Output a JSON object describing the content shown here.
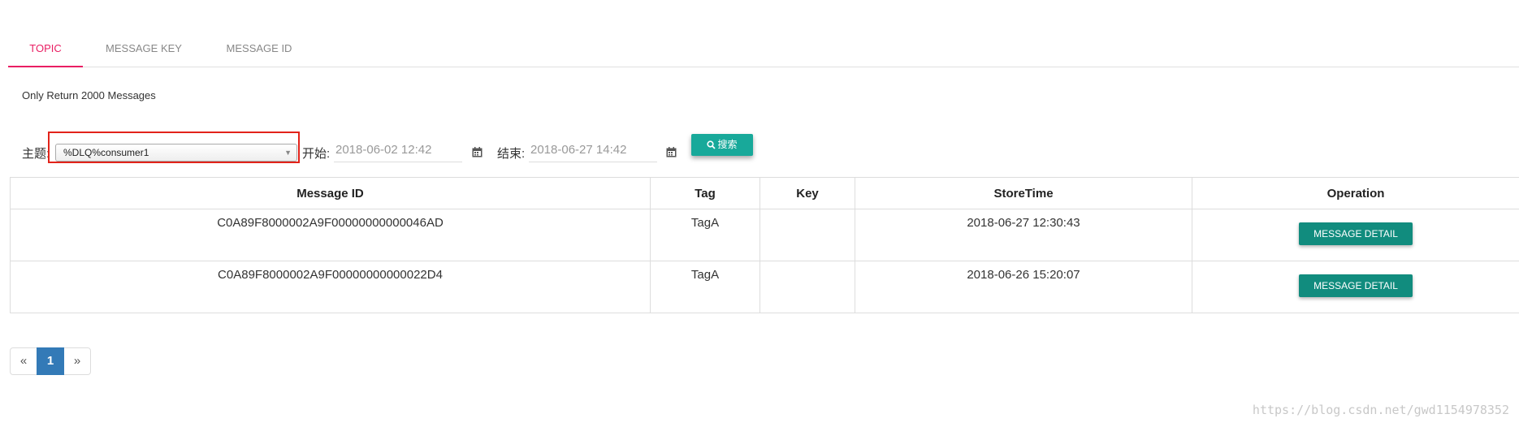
{
  "tabs": [
    {
      "label": "TOPIC",
      "active": true
    },
    {
      "label": "MESSAGE KEY",
      "active": false
    },
    {
      "label": "MESSAGE ID",
      "active": false
    }
  ],
  "note": "Only Return 2000 Messages",
  "filter": {
    "topic_label": "主题:",
    "topic_value": "%DLQ%consumer1",
    "start_label": "开始:",
    "start_value": "2018-06-02 12:42",
    "end_label": "结束:",
    "end_value": "2018-06-27 14:42",
    "search_label": "搜索"
  },
  "table": {
    "columns": [
      "Message ID",
      "Tag",
      "Key",
      "StoreTime",
      "Operation"
    ],
    "rows": [
      {
        "message_id": "C0A89F8000002A9F00000000000046AD",
        "tag": "TagA",
        "key": "",
        "store_time": "2018-06-27 12:30:43",
        "action": "MESSAGE DETAIL"
      },
      {
        "message_id": "C0A89F8000002A9F00000000000022D4",
        "tag": "TagA",
        "key": "",
        "store_time": "2018-06-26 15:20:07",
        "action": "MESSAGE DETAIL"
      }
    ]
  },
  "pagination": {
    "prev": "«",
    "current": "1",
    "next": "»"
  },
  "watermark": "https://blog.csdn.net/gwd1154978352",
  "colors": {
    "active_tab": "#e91e63",
    "search_button": "#18a99a",
    "detail_button": "#118c7e",
    "pagination_active": "#337ab7",
    "highlight_box": "#e2231a"
  }
}
